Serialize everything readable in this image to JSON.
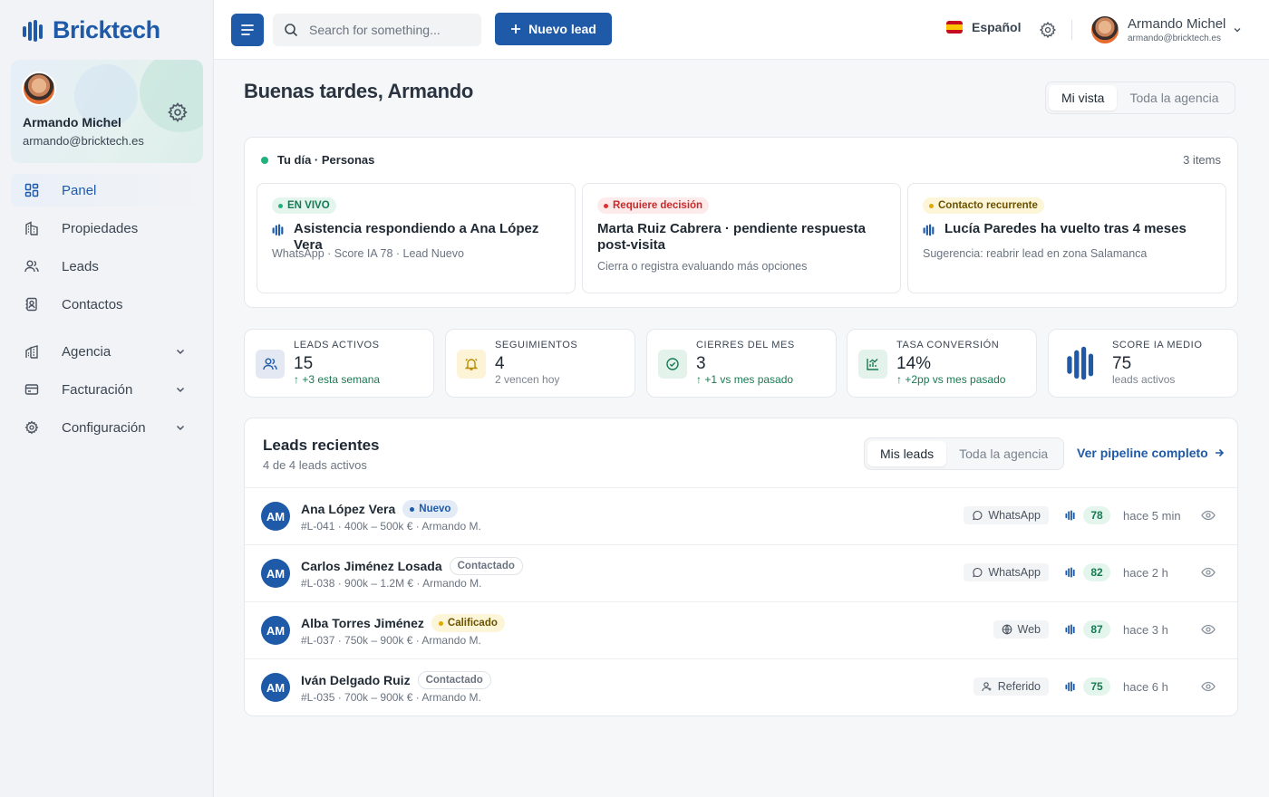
{
  "brand": {
    "name": "Bricktech",
    "color": "#1e5aa8"
  },
  "profile": {
    "name": "Armando Michel",
    "email": "armando@bricktech.es"
  },
  "nav": [
    {
      "label": "Panel",
      "icon": "dashboard-icon",
      "active": true
    },
    {
      "label": "Propiedades",
      "icon": "building-icon"
    },
    {
      "label": "Leads",
      "icon": "users-icon"
    },
    {
      "label": "Contactos",
      "icon": "contacts-icon"
    },
    {
      "label": "Agencia",
      "icon": "agency-icon",
      "expandable": true
    },
    {
      "label": "Facturación",
      "icon": "billing-icon",
      "expandable": true
    },
    {
      "label": "Configuración",
      "icon": "gear-icon",
      "expandable": true
    }
  ],
  "topbar": {
    "search_placeholder": "Search for something...",
    "new_lead": "Nuevo lead",
    "language": "Español",
    "user_name": "Armando Michel",
    "user_email": "armando@bricktech.es"
  },
  "greeting": "Buenas tardes, Armando",
  "view_toggle": {
    "options": [
      "Mi vista",
      "Toda la agencia"
    ],
    "selected": "Mi vista"
  },
  "day": {
    "title": "Tu día · Personas",
    "count": "3 items",
    "items": [
      {
        "badge": "EN VIVO",
        "title": "Asistencia respondiendo a Ana López Vera",
        "sub": "WhatsApp · Score IA 78 · Lead Nuevo"
      },
      {
        "badge": "Requiere decisión",
        "title": "Marta Ruiz Cabrera · pendiente respuesta post-visita",
        "sub": "Cierra o registra evaluando más opciones"
      },
      {
        "badge": "Contacto recurrente",
        "title": "Lucía Paredes ha vuelto tras 4 meses",
        "sub": "Sugerencia: reabrir lead en zona Salamanca"
      }
    ]
  },
  "kpis": [
    {
      "label": "LEADS ACTIVOS",
      "value": "15",
      "sub": "+3 esta semana",
      "trend": "up",
      "icon": "users-icon"
    },
    {
      "label": "SEGUIMIENTOS",
      "value": "4",
      "sub": "2 vencen hoy",
      "trend": "none",
      "icon": "bell-icon"
    },
    {
      "label": "CIERRES DEL MES",
      "value": "3",
      "sub": "+1 vs mes pasado",
      "trend": "up",
      "icon": "check-circle-icon"
    },
    {
      "label": "TASA CONVERSIÓN",
      "value": "14%",
      "sub": "+2pp vs mes pasado",
      "trend": "up",
      "icon": "chart-icon"
    },
    {
      "label": "SCORE IA MEDIO",
      "value": "75",
      "sub": "leads activos",
      "trend": "none",
      "icon": "bricktech-logo-icon"
    }
  ],
  "leads": {
    "title": "Leads recientes",
    "subtitle": "4 de 4 leads activos",
    "toggle": {
      "options": [
        "Mis leads",
        "Toda la agencia"
      ],
      "selected": "Mis leads"
    },
    "pipeline_link": "Ver pipeline completo",
    "rows": [
      {
        "initials": "AM",
        "name": "Ana López Vera",
        "status": "Nuevo",
        "meta": "#L-041 · 400k – 500k € · Armando M.",
        "channel": "WhatsApp",
        "channel_icon": "whatsapp-icon",
        "score": "78",
        "when": "hace 5 min"
      },
      {
        "initials": "AM",
        "name": "Carlos Jiménez Losada",
        "status": "Contactado",
        "meta": "#L-038 · 900k – 1.2M € · Armando M.",
        "channel": "WhatsApp",
        "channel_icon": "whatsapp-icon",
        "score": "82",
        "when": "hace 2 h"
      },
      {
        "initials": "AM",
        "name": "Alba Torres Jiménez",
        "status": "Calificado",
        "meta": "#L-037 · 750k – 900k € · Armando M.",
        "channel": "Web",
        "channel_icon": "globe-icon",
        "score": "87",
        "when": "hace 3 h"
      },
      {
        "initials": "AM",
        "name": "Iván Delgado Ruiz",
        "status": "Contactado",
        "meta": "#L-035 · 700k – 900k € · Armando M.",
        "channel": "Referido",
        "channel_icon": "referral-icon",
        "score": "75",
        "when": "hace 6 h"
      }
    ]
  }
}
